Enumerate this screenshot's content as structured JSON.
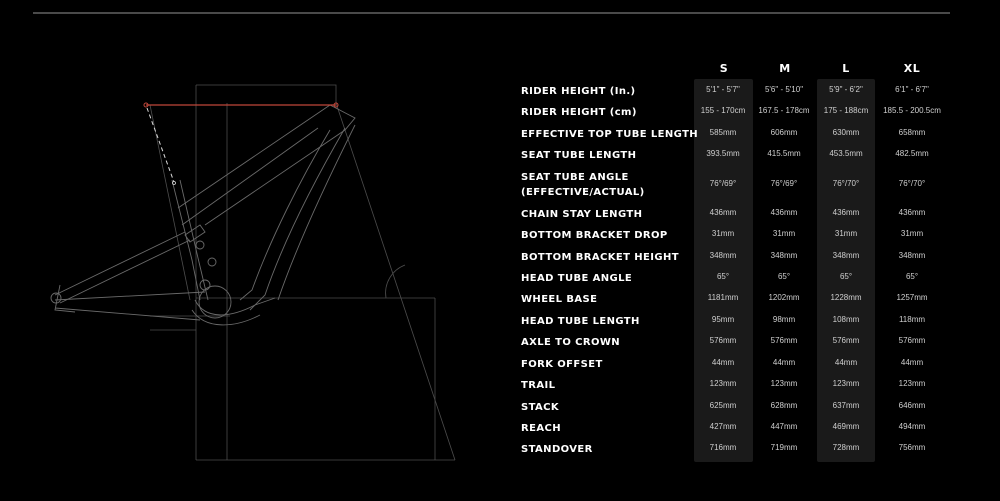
{
  "colors": {
    "background": "#000000",
    "highlight_column": "#1a1a1a",
    "top_tube_line": "#c0473a",
    "diagram_lines": "#5a5a5a",
    "label_text": "#ffffff",
    "value_text": "#cfcfcf"
  },
  "diagram": {
    "icon": "bike-frame-geometry-diagram"
  },
  "geometry": {
    "sizes": [
      "S",
      "M",
      "L",
      "XL"
    ],
    "rows": [
      {
        "label": "RIDER HEIGHT (In.)",
        "values": [
          "5'1\" - 5'7\"",
          "5'6\" - 5'10\"",
          "5'9\" - 6'2\"",
          "6'1\" - 6'7\""
        ]
      },
      {
        "label": "RIDER HEIGHT (cm)",
        "values": [
          "155 - 170cm",
          "167.5 - 178cm",
          "175 - 188cm",
          "185.5 - 200.5cm"
        ]
      },
      {
        "label": "EFFECTIVE TOP TUBE LENGTH",
        "values": [
          "585mm",
          "606mm",
          "630mm",
          "658mm"
        ]
      },
      {
        "label": "SEAT TUBE LENGTH",
        "values": [
          "393.5mm",
          "415.5mm",
          "453.5mm",
          "482.5mm"
        ]
      },
      {
        "label": "SEAT TUBE ANGLE",
        "label2": "(EFFECTIVE/ACTUAL)",
        "values": [
          "76°/69°",
          "76°/69°",
          "76°/70°",
          "76°/70°"
        ]
      },
      {
        "label": "CHAIN STAY LENGTH",
        "values": [
          "436mm",
          "436mm",
          "436mm",
          "436mm"
        ]
      },
      {
        "label": "BOTTOM BRACKET DROP",
        "values": [
          "31mm",
          "31mm",
          "31mm",
          "31mm"
        ]
      },
      {
        "label": "BOTTOM BRACKET HEIGHT",
        "values": [
          "348mm",
          "348mm",
          "348mm",
          "348mm"
        ]
      },
      {
        "label": "HEAD TUBE ANGLE",
        "values": [
          "65°",
          "65°",
          "65°",
          "65°"
        ]
      },
      {
        "label": "WHEEL BASE",
        "values": [
          "1181mm",
          "1202mm",
          "1228mm",
          "1257mm"
        ]
      },
      {
        "label": "HEAD TUBE LENGTH",
        "values": [
          "95mm",
          "98mm",
          "108mm",
          "118mm"
        ]
      },
      {
        "label": "AXLE TO CROWN",
        "values": [
          "576mm",
          "576mm",
          "576mm",
          "576mm"
        ]
      },
      {
        "label": "FORK OFFSET",
        "values": [
          "44mm",
          "44mm",
          "44mm",
          "44mm"
        ]
      },
      {
        "label": "TRAIL",
        "values": [
          "123mm",
          "123mm",
          "123mm",
          "123mm"
        ]
      },
      {
        "label": "STACK",
        "values": [
          "625mm",
          "628mm",
          "637mm",
          "646mm"
        ]
      },
      {
        "label": "REACH",
        "values": [
          "427mm",
          "447mm",
          "469mm",
          "494mm"
        ]
      },
      {
        "label": "STANDOVER",
        "values": [
          "716mm",
          "719mm",
          "728mm",
          "756mm"
        ]
      }
    ]
  }
}
